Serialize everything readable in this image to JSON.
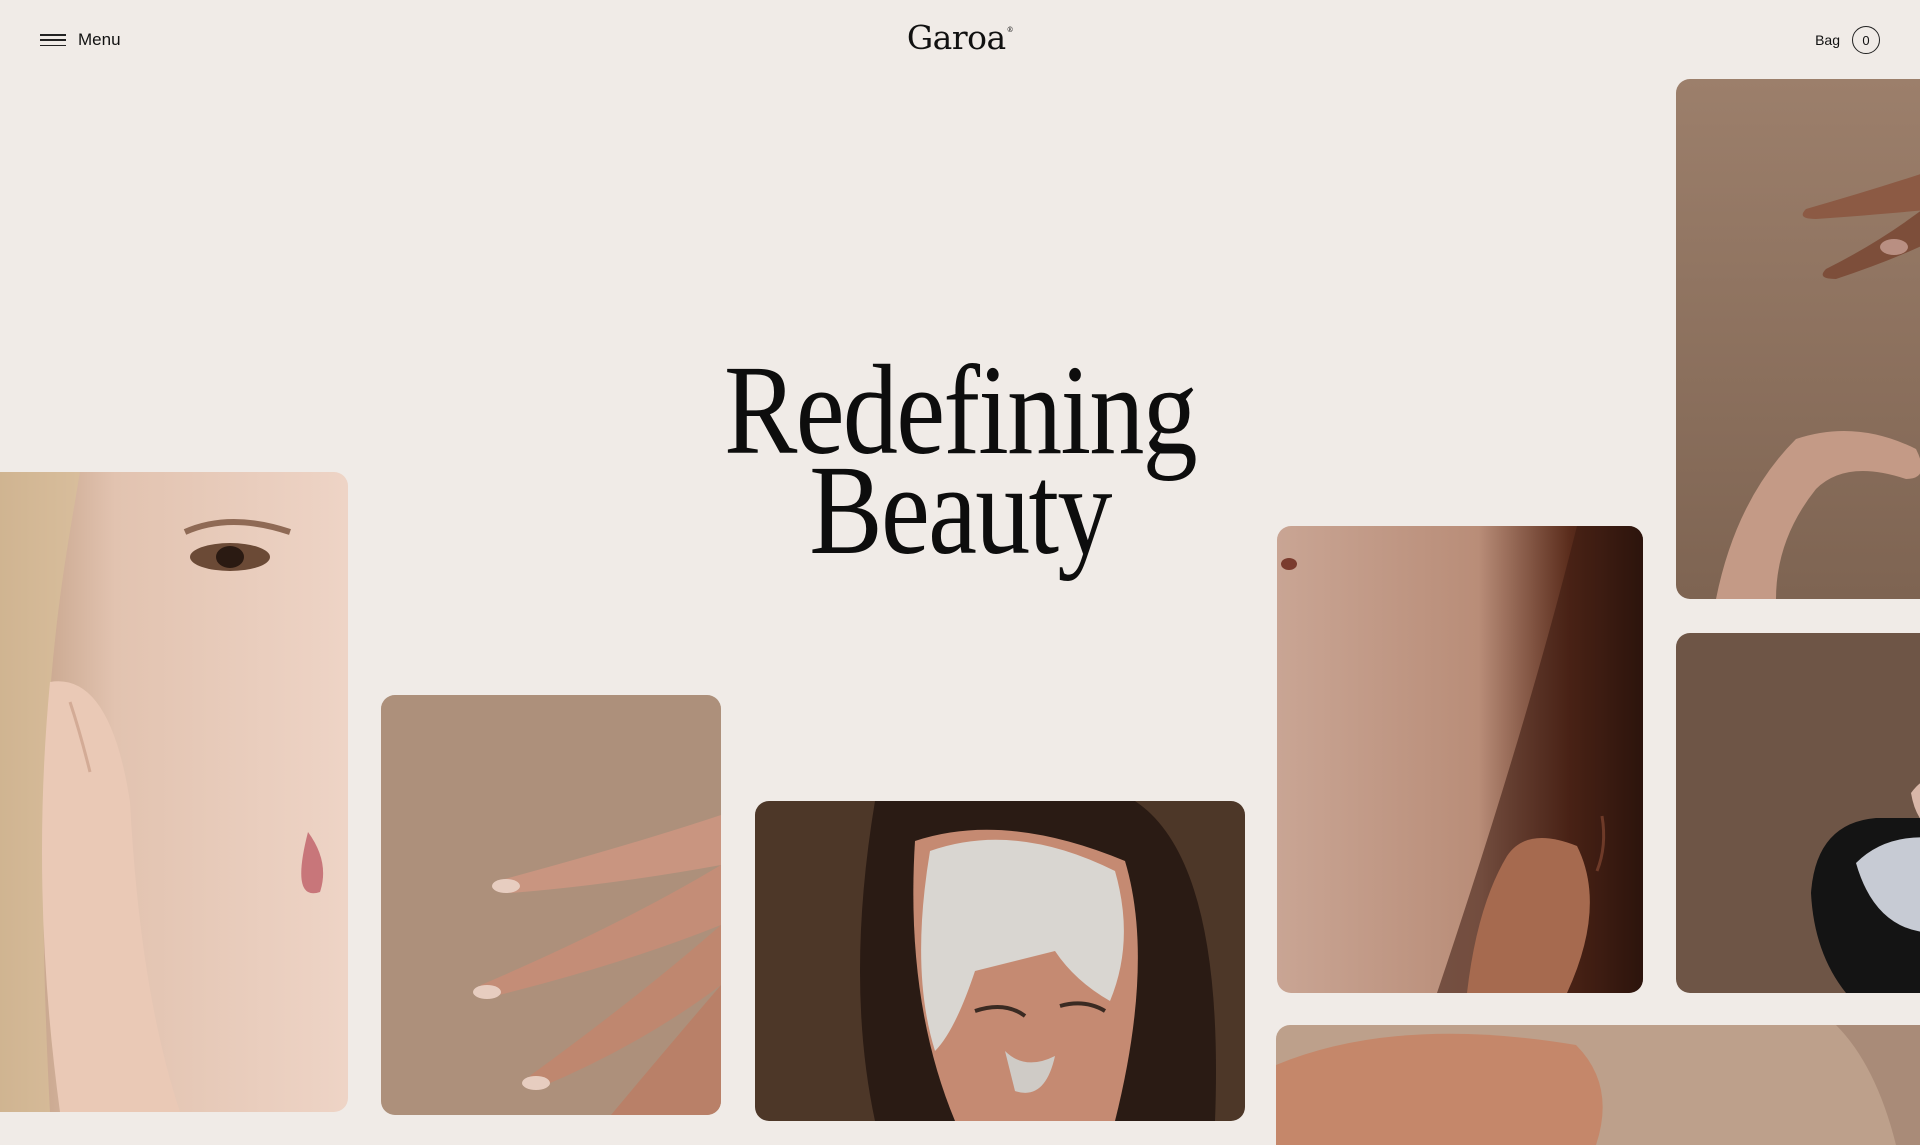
{
  "header": {
    "menu_label": "Menu",
    "logo_text": "Garoa",
    "logo_mark": "®",
    "bag_label": "Bag",
    "bag_count": "0"
  },
  "hero": {
    "line1": "Redefining",
    "line2": "Beauty"
  },
  "gallery": {
    "images": [
      {
        "name": "woman-face-closeup",
        "palette": [
          "#b08e74",
          "#e8c6b3"
        ]
      },
      {
        "name": "hand-with-manicure",
        "palette": [
          "#9f8571",
          "#d4a28e"
        ]
      },
      {
        "name": "woman-clay-mask",
        "palette": [
          "#4a3426",
          "#dcdad6"
        ]
      },
      {
        "name": "skin-closeup",
        "palette": [
          "#2b1a12",
          "#c99880"
        ]
      },
      {
        "name": "arms-gesture",
        "palette": [
          "#8c715e",
          "#a98976"
        ]
      },
      {
        "name": "bowl-of-product",
        "palette": [
          "#6d5445",
          "#1a1a1a"
        ]
      },
      {
        "name": "shoulder-closeup",
        "palette": [
          "#b99a84",
          "#c88e72"
        ]
      }
    ]
  },
  "colors": {
    "background": "#f0ebe7",
    "text": "#111111"
  }
}
